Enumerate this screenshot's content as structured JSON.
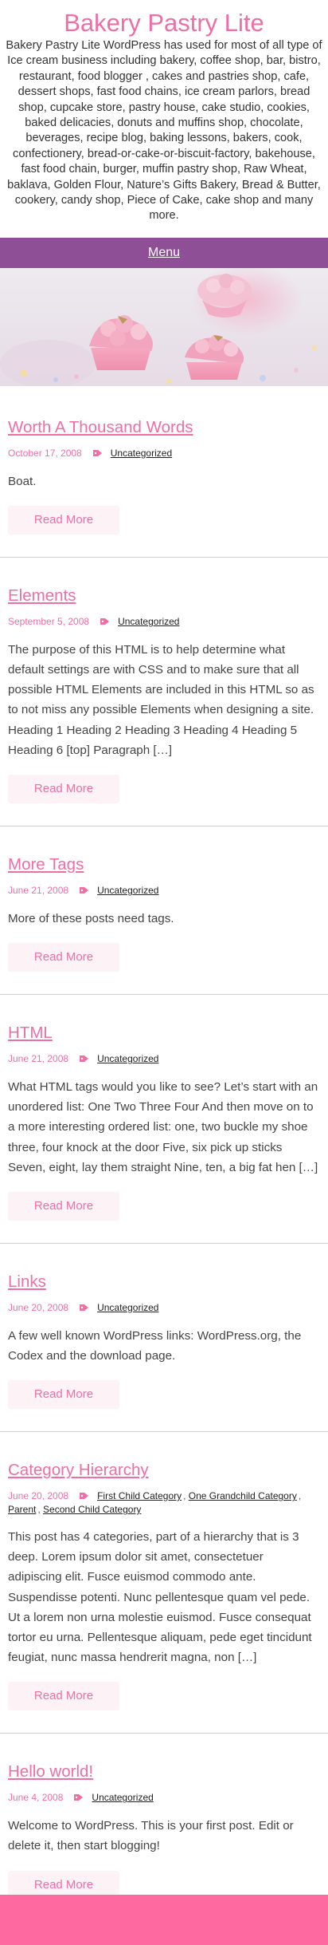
{
  "site": {
    "title": "Bakery Pastry Lite",
    "description": "Bakery Pastry Lite WordPress has used for most of all type of Ice cream business including bakery, coffee shop, bar, bistro, restaurant, food blogger , cakes and pastries shop, cafe, dessert shops, fast food chains, ice cream parlors, bread shop, cupcake store, pastry house, cake studio, cookies, baked delicacies, donuts and muffins shop, chocolate, beverages, recipe blog, baking lessons, bakers, cook, confectionery, bread-or-cake-or-biscuit-factory, bakehouse, fast food chain, burger, muffin pastry shop, Raw Wheat, baklava, Golden Flour, Nature’s Gifts Bakery, Bread & Butter, cookery, candy shop, Piece of Cake, cake shop and many more."
  },
  "menu": {
    "label": "Menu"
  },
  "colors": {
    "accent": "#ee6ea6",
    "menu_bg": "#8e4f97",
    "footer_bg": "#fe6aa0",
    "button_bg": "#fdf2f6"
  },
  "icons": {
    "category": "tag-icon"
  },
  "posts": [
    {
      "title": "Worth A Thousand Words",
      "date": "October 17, 2008",
      "categories": [
        "Uncategorized"
      ],
      "excerpt": "Boat.",
      "read_more": "Read More"
    },
    {
      "title": "Elements",
      "date": "September 5, 2008",
      "categories": [
        "Uncategorized"
      ],
      "excerpt": "The purpose of this HTML is to help determine what default settings are with CSS and to make sure that all possible HTML Elements are included in this HTML so as to not miss any possible Elements when designing a site. Heading 1 Heading 2 Heading 3 Heading 4 Heading 5 Heading 6 [top] Paragraph […]",
      "read_more": "Read More"
    },
    {
      "title": "More Tags",
      "date": "June 21, 2008",
      "categories": [
        "Uncategorized"
      ],
      "excerpt": "More of these posts need tags.",
      "read_more": "Read More"
    },
    {
      "title": "HTML",
      "date": "June 21, 2008",
      "categories": [
        "Uncategorized"
      ],
      "excerpt": "What HTML tags would you like to see? Let’s start with an unordered list: One Two Three Four And then move on to a more interesting ordered list: one, two buckle my shoe three, four knock at the door Five, six pick up sticks Seven, eight, lay them straight Nine, ten, a big fat hen […]",
      "read_more": "Read More"
    },
    {
      "title": "Links",
      "date": "June 20, 2008",
      "categories": [
        "Uncategorized"
      ],
      "excerpt": "A few well known WordPress links: WordPress.org, the Codex and the download page.",
      "read_more": "Read More"
    },
    {
      "title": "Category Hierarchy",
      "date": "June 20, 2008",
      "categories": [
        "First Child Category",
        "One Grandchild Category",
        "Parent",
        "Second Child Category"
      ],
      "excerpt": "This post has 4 categories, part of a hierarchy that is 3 deep. Lorem ipsum dolor sit amet, consectetuer adipiscing elit. Fusce euismod commodo ante. Suspendisse potenti. Nunc pellentesque quam vel pede. Ut a lorem non urna molestie euismod. Fusce consequat tortor eu urna. Pellentesque aliquam, pede eget tincidunt feugiat, nunc massa hendrerit magna, non […]",
      "read_more": "Read More"
    },
    {
      "title": "Hello world!",
      "date": "June 4, 2008",
      "categories": [
        "Uncategorized"
      ],
      "excerpt": "Welcome to WordPress. This is your first post. Edit or delete it, then start blogging!",
      "read_more": "Read More"
    }
  ]
}
